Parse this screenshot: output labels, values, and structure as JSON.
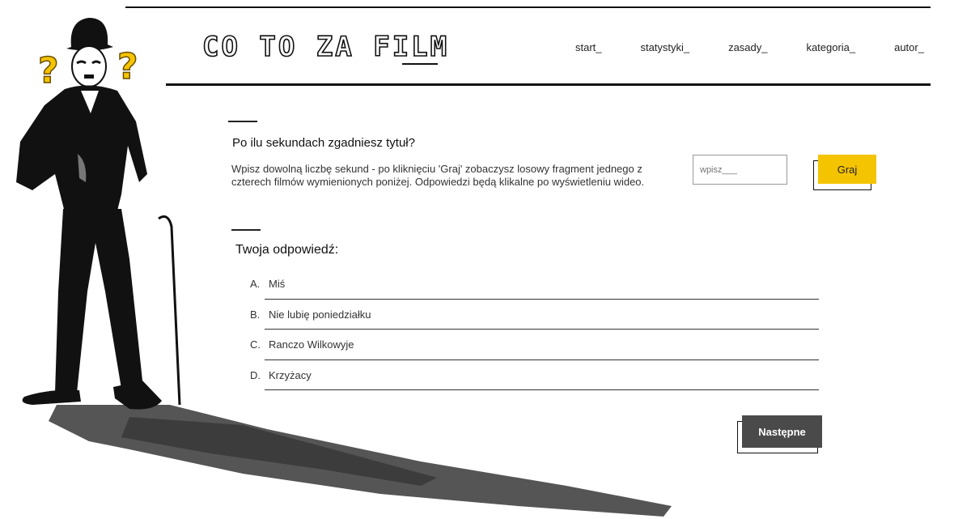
{
  "header": {
    "logo": "CO TO ZA FILM",
    "nav": [
      "start_",
      "statystyki_",
      "zasady_",
      "kategoria_",
      "autor_"
    ]
  },
  "quiz": {
    "question_title": "Po ilu sekundach zgadniesz tytuł?",
    "description": "Wpisz dowolną liczbę sekund - po kliknięciu 'Graj' zobaczysz losowy fragment jednego z czterech filmów wymienionych poniżej. Odpowiedzi będą klikalne po wyświetleniu wideo.",
    "seconds_placeholder": "wpisz___",
    "play_label": "Graj"
  },
  "answers": {
    "title": "Twoja odpowiedź:",
    "items": [
      {
        "letter": "A.",
        "text": "Miś"
      },
      {
        "letter": "B.",
        "text": "Nie lubię poniedziałku"
      },
      {
        "letter": "C.",
        "text": "Ranczo Wilkowyje"
      },
      {
        "letter": "D.",
        "text": "Krzyżacy"
      }
    ]
  },
  "next_label": "Następne",
  "colors": {
    "accent": "#f5c400",
    "dark_button": "#4a4a4a",
    "text": "#222222"
  }
}
